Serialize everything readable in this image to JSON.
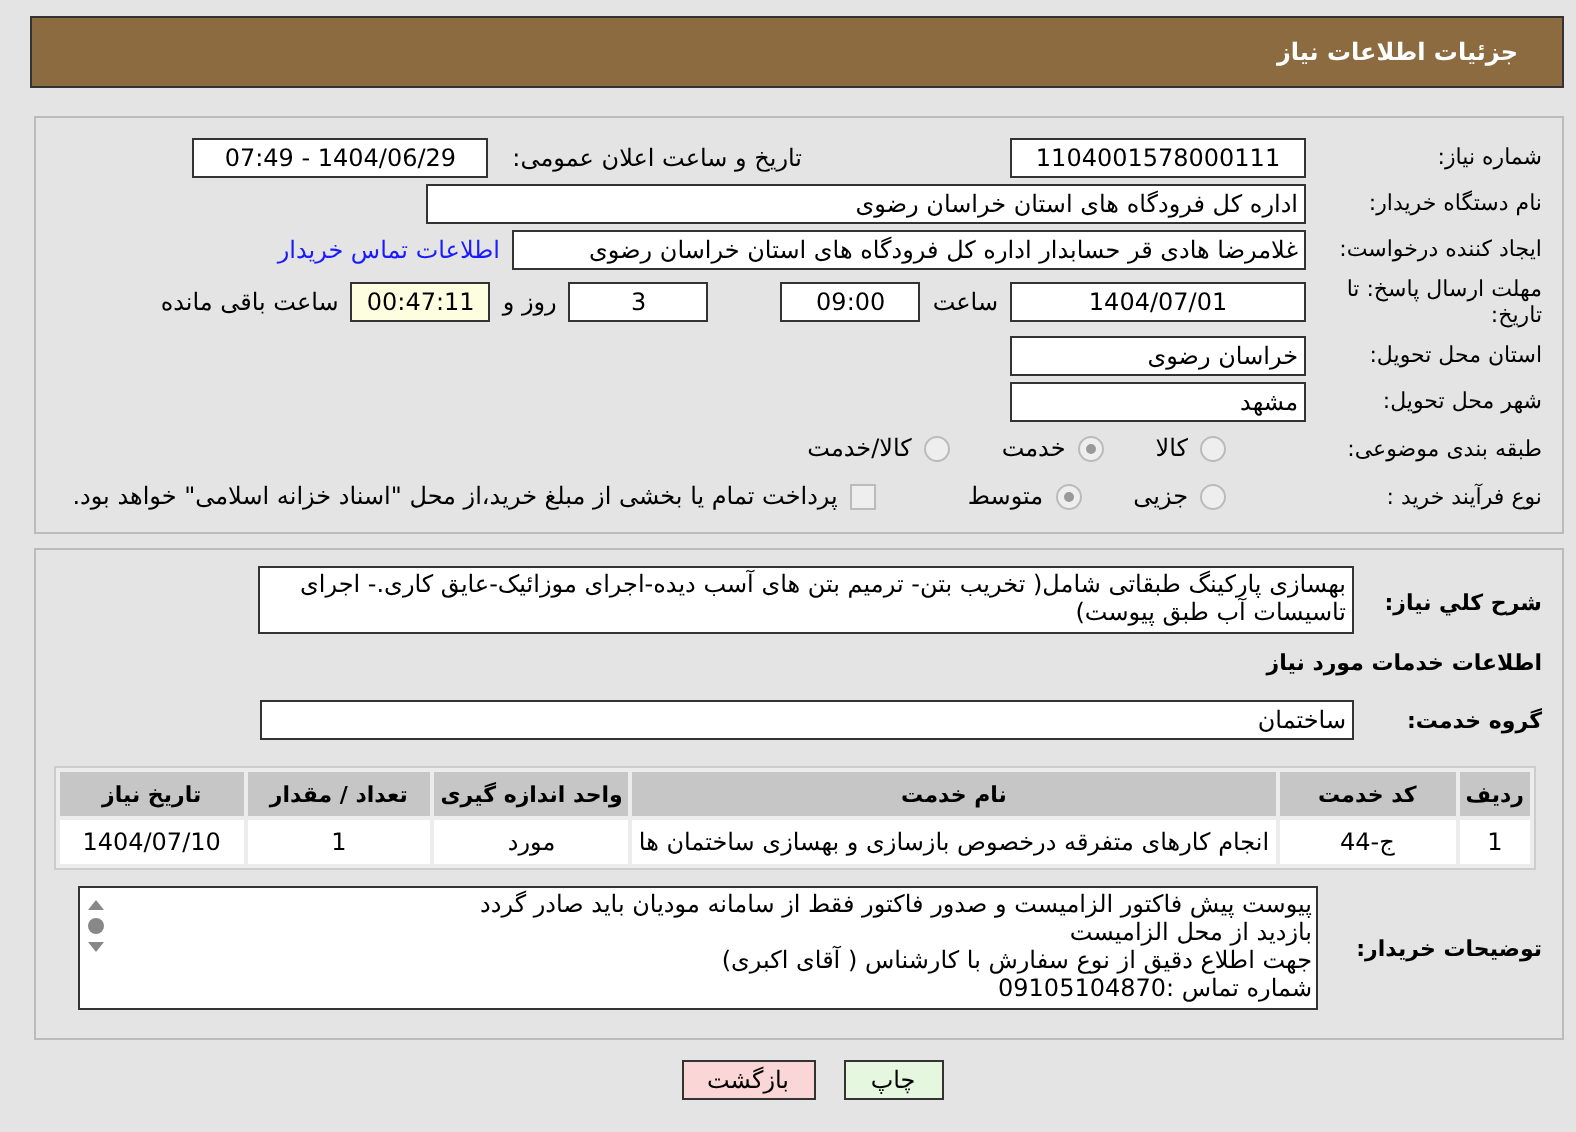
{
  "header": {
    "title": "جزئیات اطلاعات نیاز"
  },
  "need_number": {
    "label": "شماره نیاز:",
    "value": "1104001578000111"
  },
  "announce": {
    "label": "تاریخ و ساعت اعلان عمومی:",
    "value": "1404/06/29 - 07:49"
  },
  "buyer_org": {
    "label": "نام دستگاه خریدار:",
    "value": "اداره کل فرودگاه های استان خراسان رضوی"
  },
  "requester": {
    "label": "ایجاد کننده درخواست:",
    "value": "غلامرضا هادی قر حسابدار اداره کل فرودگاه های استان خراسان رضوی",
    "link": "اطلاعات تماس خریدار"
  },
  "deadline": {
    "label": "مهلت ارسال پاسخ: تا تاریخ:",
    "date": "1404/07/01",
    "time_label": "ساعت",
    "time": "09:00",
    "days": "3",
    "days_label": "روز و",
    "remaining": "00:47:11",
    "remaining_label": "ساعت باقی مانده"
  },
  "province": {
    "label": "استان محل تحویل:",
    "value": "خراسان رضوی"
  },
  "city": {
    "label": "شهر محل تحویل:",
    "value": "مشهد"
  },
  "category": {
    "label": "طبقه بندی موضوعی:",
    "options": [
      {
        "label": "کالا",
        "selected": false
      },
      {
        "label": "خدمت",
        "selected": true
      },
      {
        "label": "کالا/خدمت",
        "selected": false
      }
    ]
  },
  "process": {
    "label": "نوع فرآیند خرید :",
    "options": [
      {
        "label": "جزیی",
        "selected": false
      },
      {
        "label": "متوسط",
        "selected": true
      }
    ],
    "payment": {
      "checked": false,
      "text": "پرداخت تمام یا بخشی از مبلغ خرید،از محل \"اسناد خزانه اسلامی\" خواهد بود."
    }
  },
  "description": {
    "label": "شرح کلي نياز:",
    "value": "بهسازی پارکینگ طبقاتی شامل( تخریب بتن- ترمیم بتن های آسب دیده-اجرای موزائیک-عایق کاری.- اجرای تاسیسات آب طبق پیوست)"
  },
  "services_title": "اطلاعات خدمات مورد نیاز",
  "service_group": {
    "label": "گروه خدمت:",
    "value": "ساختمان"
  },
  "table": {
    "columns": [
      "ردیف",
      "کد خدمت",
      "نام خدمت",
      "واحد اندازه گیری",
      "تعداد / مقدار",
      "تاریخ نیاز"
    ],
    "rows": [
      [
        "1",
        "ج-44",
        "انجام کارهای متفرقه درخصوص بازسازی و بهسازی ساختمان ها",
        "مورد",
        "1",
        "1404/07/10"
      ]
    ]
  },
  "notes": {
    "label": "توضیحات خریدار:",
    "lines": [
      "پیوست پیش فاکتور الزامیست و صدور فاکتور فقط از سامانه مودیان باید صادر گردد",
      "بازدید از محل الزامیست",
      "جهت اطلاع دقیق از نوع سفارش با کارشناس   ( آقای اکبری)",
      "شماره تماس :09105104870"
    ]
  },
  "buttons": [
    {
      "kind": "print",
      "label": "چاپ"
    },
    {
      "kind": "back",
      "label": "بازگشت"
    }
  ]
}
